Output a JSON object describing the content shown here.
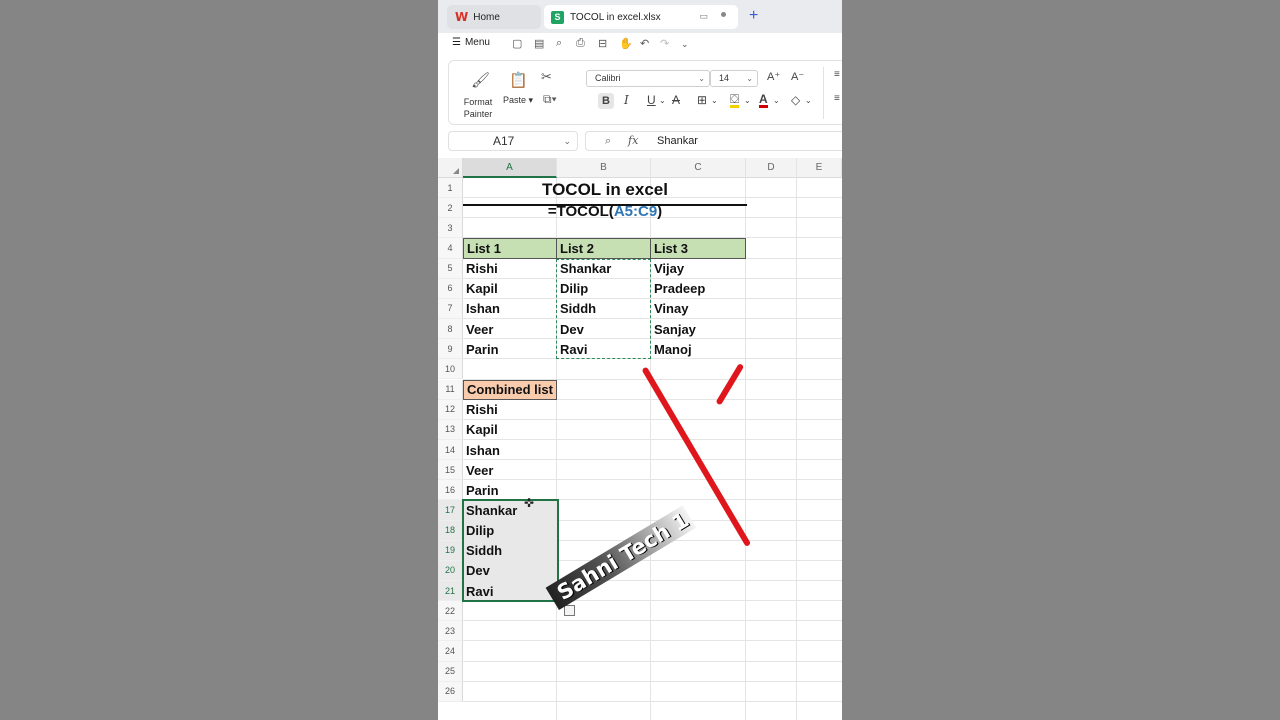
{
  "tabs": {
    "home": "Home",
    "file": "TOCOL in excel.xlsx"
  },
  "quickbar": {
    "menu": "Menu"
  },
  "ribbon": {
    "format_painter_line1": "Format",
    "format_painter_line2": "Painter",
    "paste": "Paste",
    "font_name": "Calibri",
    "font_size": "14",
    "bold": "B",
    "italic": "I",
    "underline": "U"
  },
  "formula_bar": {
    "name_box": "A17",
    "fx": "fx",
    "value": "Shankar"
  },
  "columns": [
    "A",
    "B",
    "C",
    "D",
    "E"
  ],
  "rows": [
    "1",
    "2",
    "3",
    "4",
    "5",
    "6",
    "7",
    "8",
    "9",
    "10",
    "11",
    "12",
    "13",
    "14",
    "15",
    "16",
    "17",
    "18",
    "19",
    "20",
    "21",
    "22",
    "23",
    "24",
    "25",
    "26"
  ],
  "sheet": {
    "title": "TOCOL in excel",
    "formula_prefix": "=TOCOL(",
    "formula_ref": "A5:C9",
    "formula_suffix": ")",
    "headers": [
      "List 1",
      "List 2",
      "List 3"
    ],
    "list1": [
      "Rishi",
      "Kapil",
      "Ishan",
      "Veer",
      "Parin"
    ],
    "list2": [
      "Shankar",
      "Dilip",
      "Siddh",
      "Dev",
      "Ravi"
    ],
    "list3": [
      "Vijay",
      "Pradeep",
      "Vinay",
      "Sanjay",
      "Manoj"
    ],
    "combined_header": "Combined list",
    "combined": [
      "Rishi",
      "Kapil",
      "Ishan",
      "Veer",
      "Parin",
      "Shankar",
      "Dilip",
      "Siddh",
      "Dev",
      "Ravi"
    ]
  },
  "watermark": "Sahni Tech 1",
  "colors": {
    "accent_green": "#217346",
    "header_green": "#c6e0b4",
    "header_orange": "#f8cbad",
    "formula_ref_blue": "#2e75b6",
    "annotation_red": "#e0161d"
  }
}
